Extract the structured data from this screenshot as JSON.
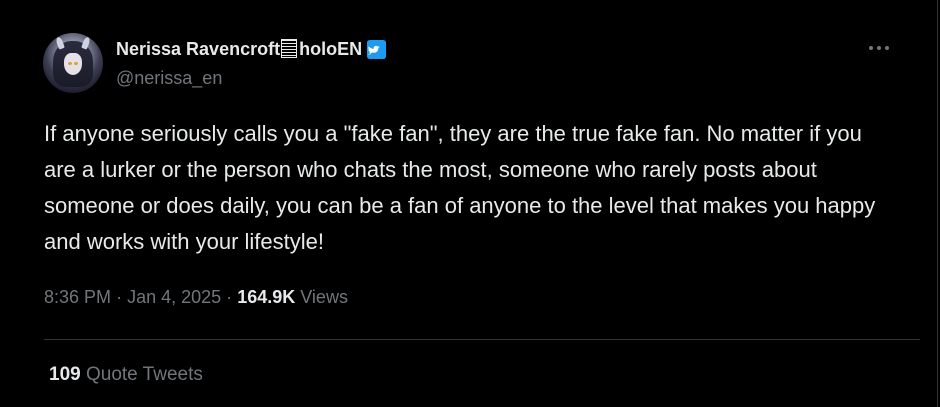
{
  "author": {
    "display_name_prefix": "Nerissa Ravencroft",
    "display_name_suffix": "holoEN",
    "handle": "@nerissa_en",
    "avatar_icon": "avatar-image",
    "verified_icon": "verified-badge-icon",
    "verified_color": "#1d9bf0"
  },
  "menu": {
    "more_icon": "more-options-icon"
  },
  "tweet": {
    "text": "If anyone seriously calls you a \"fake fan\", they are the true fake fan. No matter if you are a lurker or the person who chats the most, someone who rarely posts about someone or does daily, you can be a fan of anyone to the level that makes you happy and works with your lifestyle!"
  },
  "meta": {
    "time": "8:36 PM",
    "separator": "·",
    "date": "Jan 4, 2025",
    "views_count": "164.9K",
    "views_label": "Views"
  },
  "engagement": {
    "quote_count": "109",
    "quote_label": "Quote Tweets"
  },
  "colors": {
    "background": "#000000",
    "text_primary": "#e7e9ea",
    "text_secondary": "#71767b",
    "divider": "#2f3336"
  }
}
